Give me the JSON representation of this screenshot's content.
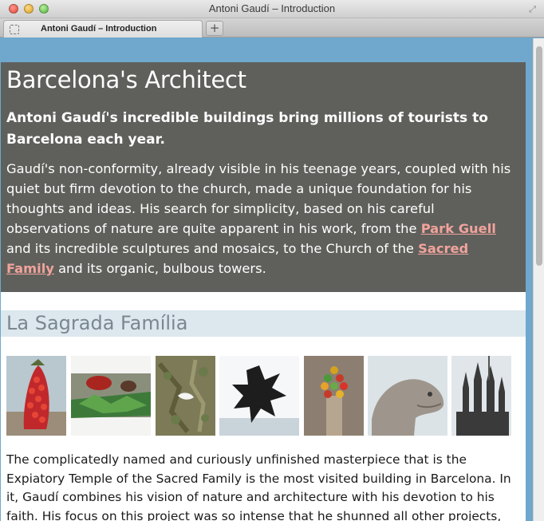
{
  "window": {
    "title": "Antoni Gaudí – Introduction"
  },
  "tabs": [
    {
      "label": "Antoni Gaudí – Introduction"
    }
  ],
  "new_tab_label": "+",
  "page": {
    "title": "Barcelona's Architect",
    "lead": "Antoni Gaudí's incredible buildings bring millions of tourists to Barcelona each year.",
    "intro": {
      "part1": "Gaudí's non-conformity, already visible in his teenage years, coupled with his quiet but firm devotion to the church, made a unique foundation for his thoughts and ideas. His search for simplicity, based on his careful observations of nature are quite apparent in his work, from the ",
      "link1": "Park Guell",
      "part2": " and its incredible sculptures and mosaics, to the Church of the ",
      "link2": "Sacred Family",
      "part3": " and its organic, bulbous towers."
    },
    "section_heading": "La Sagrada Família",
    "article": "The complicatedly named and curiously unfinished masterpiece that is the Expiatory Temple of the Sacred Family is the most visited building in Barcelona. In it, Gaudí combines his vision of nature and architecture with his devotion to his faith. His focus on this project was so intense that he shunned all other projects, slept in an apartment at"
  },
  "colors": {
    "page_background": "#6fa8cc",
    "intro_background": "#5f605c",
    "link": "#f2a39c",
    "section_band": "#dce7ee",
    "section_text": "#7a8790"
  }
}
